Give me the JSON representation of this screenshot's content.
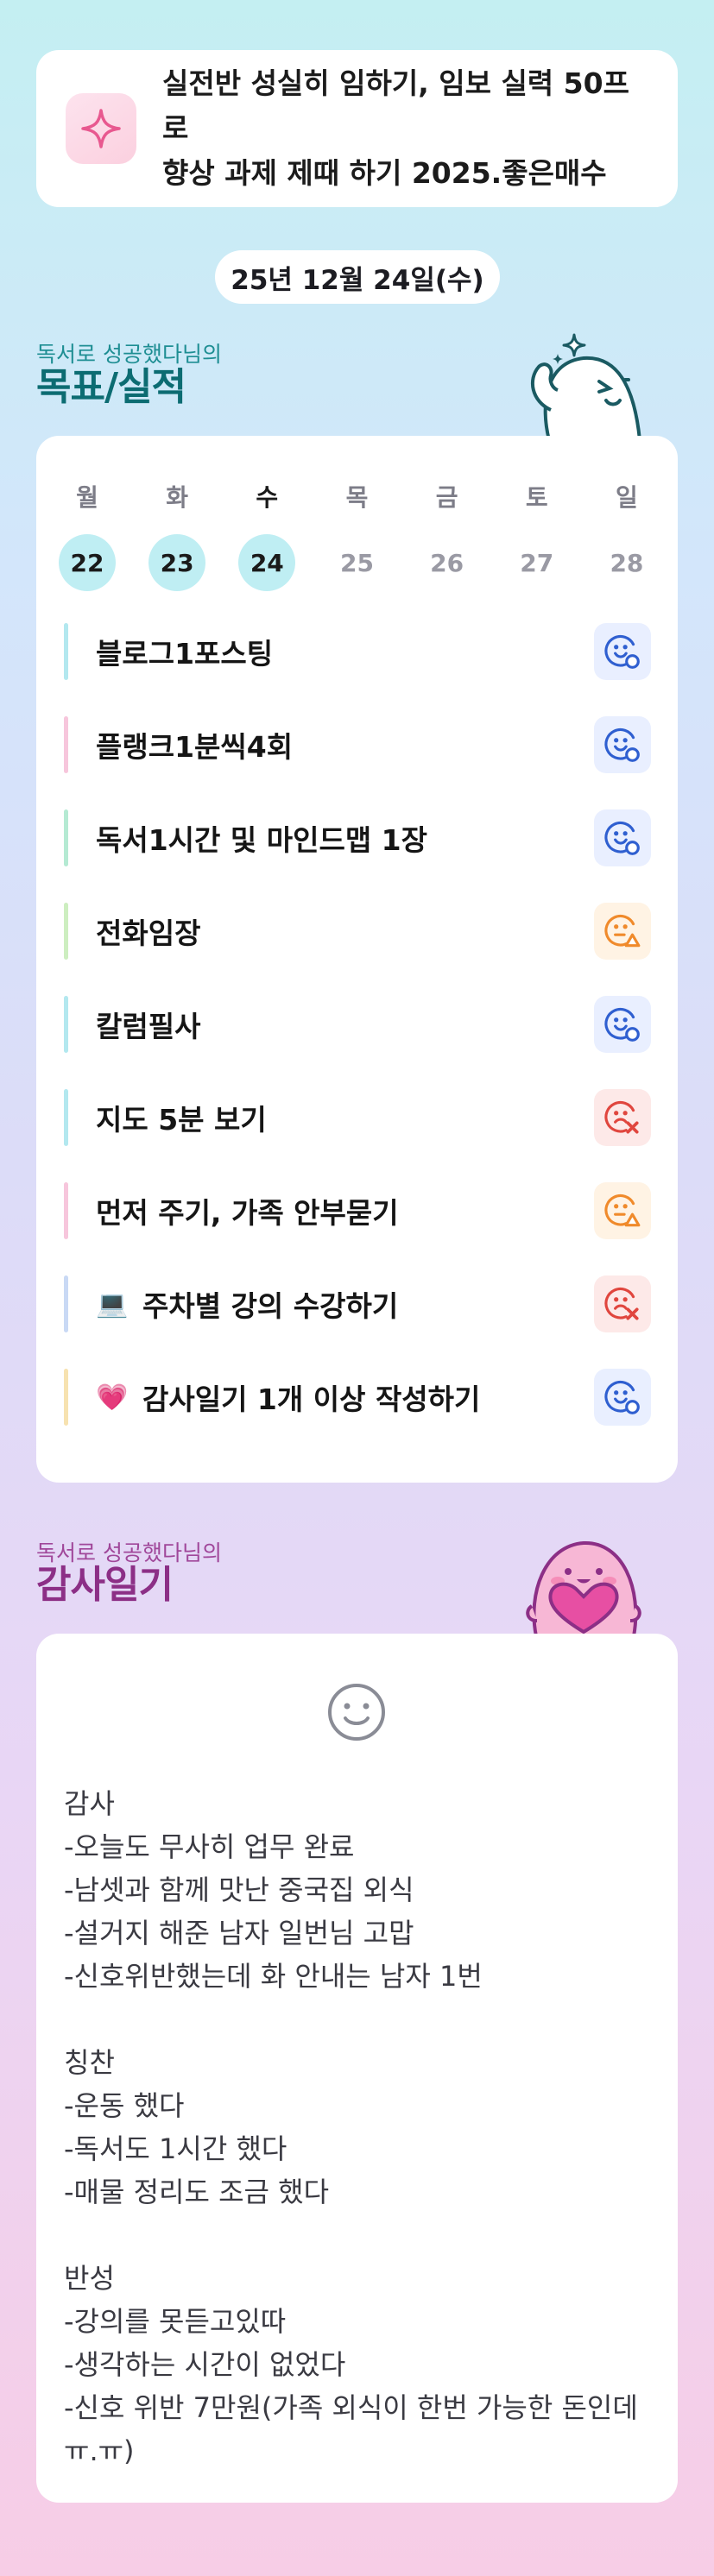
{
  "goal": {
    "line1": "실전반 성실히 임하기, 임보 실력 50프로",
    "line2": "향상 과제 제때 하기 2025.좋은매수",
    "icon": "sparkle-icon",
    "accent": "#e8588f"
  },
  "date": "25년 12월 24일(수)",
  "plan_section": {
    "subtitle": "독서로 성공했다님의",
    "title": "목표/실적"
  },
  "week": [
    {
      "name": "월",
      "num": "22",
      "done": true
    },
    {
      "name": "화",
      "num": "23",
      "done": true
    },
    {
      "name": "수",
      "num": "24",
      "done": true,
      "today": true
    },
    {
      "name": "목",
      "num": "25",
      "done": false
    },
    {
      "name": "금",
      "num": "26",
      "done": false
    },
    {
      "name": "토",
      "num": "27",
      "done": false
    },
    {
      "name": "일",
      "num": "28",
      "done": false
    }
  ],
  "tasks": [
    {
      "label": "블로그1포스팅",
      "emoji": "",
      "bar": "#b3e8ef",
      "status": "done"
    },
    {
      "label": "플랭크1분씩4회",
      "emoji": "",
      "bar": "#f7c6dc",
      "status": "done"
    },
    {
      "label": "독서1시간 및 마인드맵 1장",
      "emoji": "",
      "bar": "#b5ead3",
      "status": "done"
    },
    {
      "label": "전화임장",
      "emoji": "",
      "bar": "#cdeec0",
      "status": "partial"
    },
    {
      "label": "칼럼필사",
      "emoji": "",
      "bar": "#b3e8ef",
      "status": "done"
    },
    {
      "label": "지도 5분 보기",
      "emoji": "",
      "bar": "#b3e8ef",
      "status": "fail"
    },
    {
      "label": "먼저 주기, 가족 안부묻기",
      "emoji": "",
      "bar": "#f7c6dc",
      "status": "partial"
    },
    {
      "label": "주차별 강의 수강하기",
      "emoji": "💻",
      "bar": "#c9d9f5",
      "status": "fail"
    },
    {
      "label": "감사일기 1개 이상 작성하기",
      "emoji": "💗",
      "bar": "#f7e2b0",
      "status": "done"
    }
  ],
  "status_colors": {
    "done": {
      "fg": "#2f5fd0",
      "bg": "#e9efff"
    },
    "partial": {
      "fg": "#f08a2b",
      "bg": "#fff3e4"
    },
    "fail": {
      "fg": "#e0463e",
      "bg": "#fde9e8"
    }
  },
  "diary_section": {
    "subtitle": "독서로 성공했다님의",
    "title": "감사일기"
  },
  "diary": {
    "mood_icon": "smile-face-icon",
    "text": "감사\n-오늘도 무사히 업무 완료\n-남셋과 함께 맛난 중국집 외식\n-설거지 해준 남자 일번님 고맙\n-신호위반했는데 화 안내는 남자 1번\n\n칭찬\n-운동 했다\n-독서도 1시간 했다\n-매물 정리도 조금 했다\n\n반성\n-강의를 못듣고있따\n-생각하는 시간이 없었다\n-신호 위반 7만원(가족 외식이 한번 가능한 돈인데\nㅠ.ㅠ)"
  }
}
